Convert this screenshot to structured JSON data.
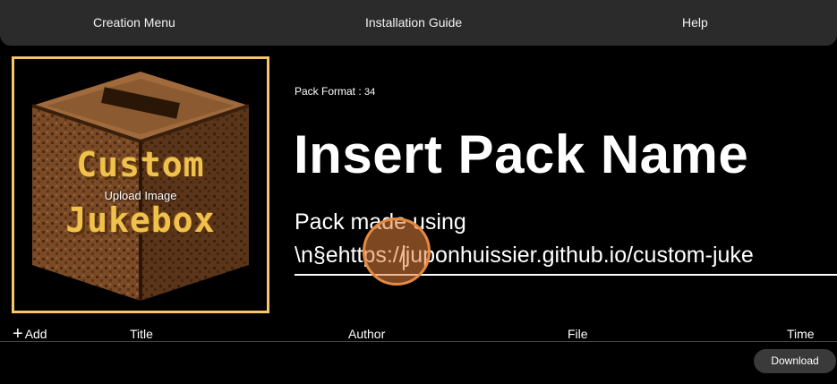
{
  "nav": {
    "creation_menu": "Creation Menu",
    "installation_guide": "Installation Guide",
    "help": "Help"
  },
  "cover": {
    "logo_line1": "Custom",
    "logo_line2": "Jukebox",
    "upload_label": "Upload Image",
    "frame_color": "#f5c768"
  },
  "pack": {
    "format_label": "Pack Format :",
    "format_value": "34",
    "name": "Insert Pack Name",
    "description": "Pack made using\n\\n§ehttps://juponhuissier.github.io/custom-juke"
  },
  "table": {
    "add_label": "Add",
    "columns": [
      "Title",
      "Author",
      "File",
      "Time"
    ]
  },
  "download_label": "Download",
  "icons": {
    "add": "plus-icon"
  }
}
